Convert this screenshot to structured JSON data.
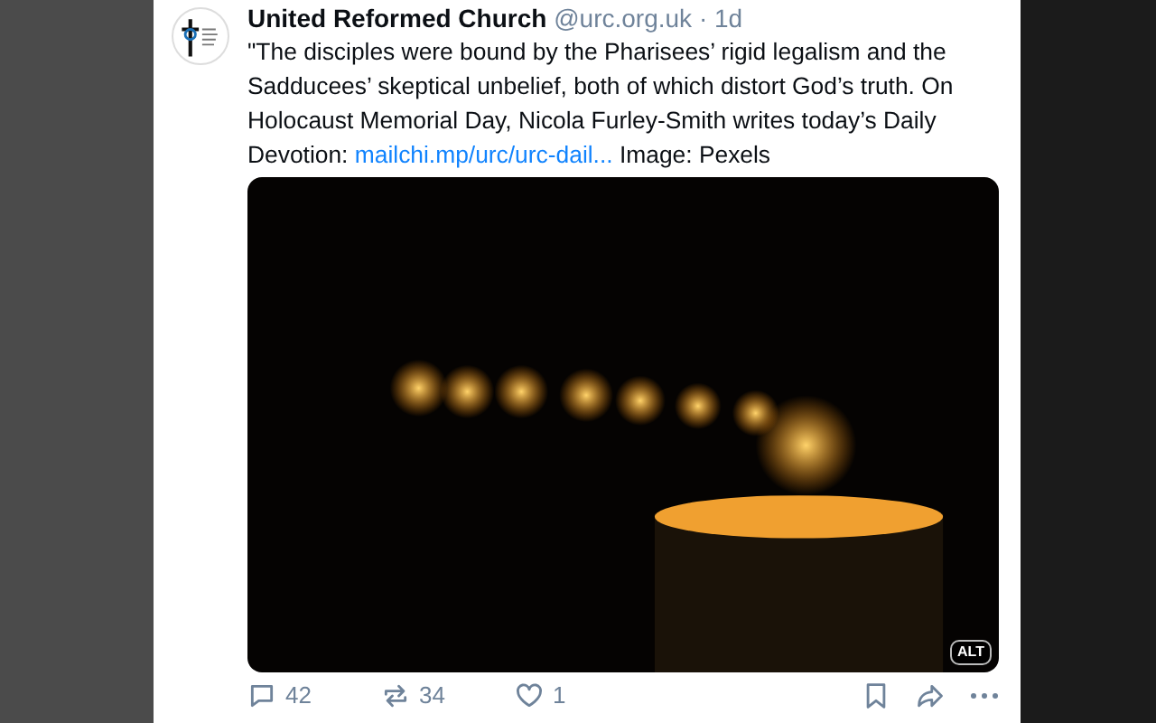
{
  "post": {
    "author": "United Reformed Church",
    "handle": "@urc.org.uk",
    "separator": "·",
    "age": "1d",
    "text_before": "\"The disciples were bound by the Pharisees’ rigid legalism and the Sadducees’ skeptical unbelief, both of which distort God’s truth. On Holocaust Memorial Day, Nicola Furley-Smith writes today’s Daily Devotion: ",
    "link": "mailchi.mp/urc/urc-dail...",
    "text_after": " Image: Pexels",
    "image_badge": "ALT",
    "actions": [
      {
        "kind": "reply",
        "count": "42"
      },
      {
        "kind": "repost",
        "count": "34"
      },
      {
        "kind": "like",
        "count": "1"
      }
    ],
    "tools": [
      {
        "kind": "bookmark"
      },
      {
        "kind": "share"
      },
      {
        "kind": "more"
      }
    ]
  }
}
